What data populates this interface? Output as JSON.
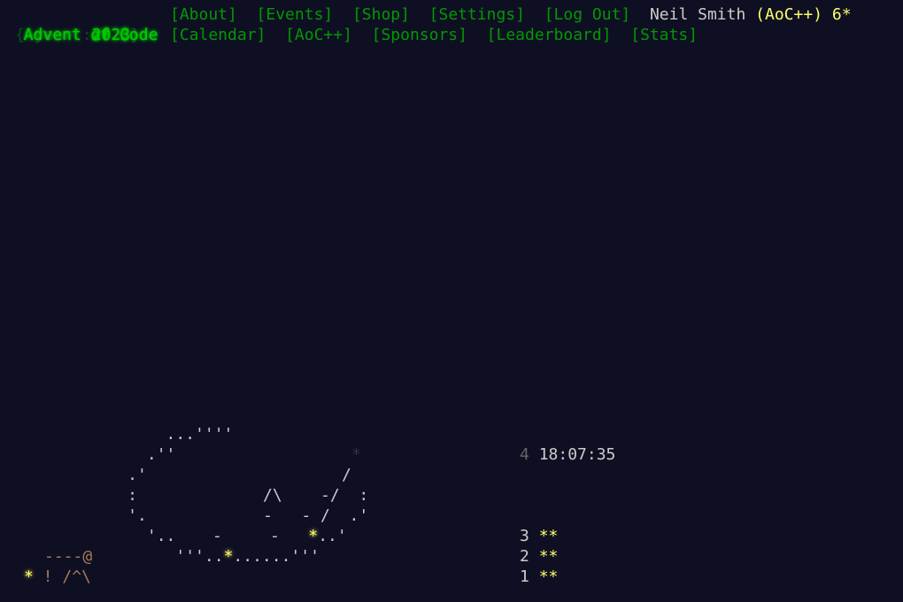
{
  "header": {
    "title": "Advent of Code",
    "year_prefix": "{'year':",
    "year": "2023",
    "year_suffix": "}",
    "nav_row1": [
      "[About]",
      "[Events]",
      "[Shop]",
      "[Settings]",
      "[Log Out]"
    ],
    "user_name": "Neil Smith",
    "aocpp_tag": "(AoC++)",
    "star_count": "6*",
    "nav_row2": [
      "[Calendar]",
      "[AoC++]",
      "[Sponsors]",
      "[Leaderboard]",
      "[Stats]"
    ]
  },
  "calendar": {
    "art_lines": [
      "         ...''''",
      "       .''",
      "     .'",
      "     :",
      "     '.",
      "       '..",
      "          '''..",
      "* ! /^\\"
    ],
    "rope": "----@",
    "days": [
      {
        "day": "4",
        "timer": "18:07:35",
        "stars": ""
      },
      {
        "day": "3",
        "timer": "",
        "stars": "**"
      },
      {
        "day": "2",
        "timer": "",
        "stars": "**"
      },
      {
        "day": "1",
        "timer": "",
        "stars": "**"
      }
    ]
  }
}
